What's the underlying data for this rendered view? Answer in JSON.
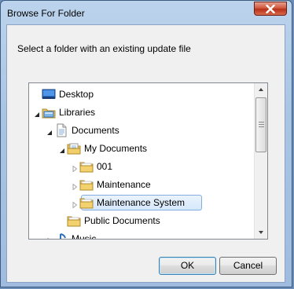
{
  "window": {
    "title": "Browse For Folder"
  },
  "instruction": "Select a folder with an existing update file",
  "tree": [
    {
      "label": "Desktop",
      "icon": "desktop-icon",
      "expander": "none",
      "level": 0
    },
    {
      "label": "Libraries",
      "icon": "libraries-folder-icon",
      "expander": "expanded",
      "level": 0
    },
    {
      "label": "Documents",
      "icon": "documents-library-icon",
      "expander": "expanded",
      "level": 1
    },
    {
      "label": "My Documents",
      "icon": "my-documents-icon",
      "expander": "expanded",
      "level": 2
    },
    {
      "label": "001",
      "icon": "folder-icon",
      "expander": "collapsed",
      "level": 3
    },
    {
      "label": "Maintenance",
      "icon": "folder-icon",
      "expander": "collapsed",
      "level": 3
    },
    {
      "label": "Maintenance System",
      "icon": "folder-icon",
      "expander": "collapsed",
      "level": 3,
      "selected": true
    },
    {
      "label": "Public Documents",
      "icon": "folder-icon",
      "expander": "none",
      "level": 2
    },
    {
      "label": "Music",
      "icon": "music-icon",
      "expander": "collapsed",
      "level": 1
    }
  ],
  "buttons": {
    "ok": "OK",
    "cancel": "Cancel"
  }
}
